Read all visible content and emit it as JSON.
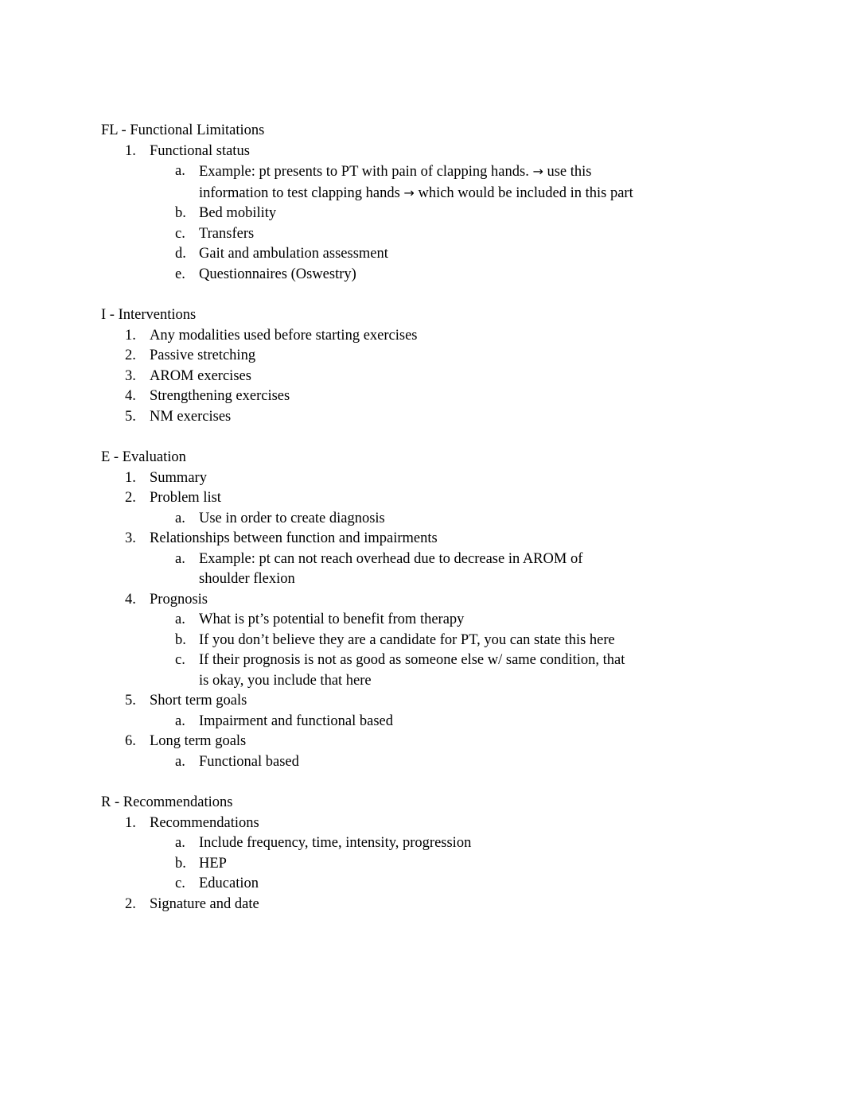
{
  "document": {
    "title": "FL - Functional Limitations",
    "page_background": "#ffffff",
    "text_color": "#000000",
    "sections": [
      {
        "heading": "FL - Functional Limitations",
        "items": [
          {
            "marker": "1.",
            "text": "Functional status",
            "children": [
              {
                "marker": "a.",
                "text": "Example: pt presents to PT with pain of clapping hands. → use this information to test clapping hands → which would be included in this part"
              },
              {
                "marker": "b.",
                "text": "Bed mobility"
              },
              {
                "marker": "c.",
                "text": "Transfers"
              },
              {
                "marker": "d.",
                "text": "Gait and ambulation assessment"
              },
              {
                "marker": "e.",
                "text": "Questionnaires (Oswestry)"
              }
            ]
          }
        ]
      },
      {
        "heading": "I - Interventions",
        "items": [
          {
            "marker": "1.",
            "text": "Any modalities used before starting exercises",
            "children": []
          },
          {
            "marker": "2.",
            "text": "Passive stretching",
            "children": []
          },
          {
            "marker": "3.",
            "text": "AROM exercises",
            "children": []
          },
          {
            "marker": "4.",
            "text": "Strengthening exercises",
            "children": []
          },
          {
            "marker": "5.",
            "text": "NM exercises",
            "children": []
          }
        ]
      },
      {
        "heading": "E - Evaluation",
        "items": [
          {
            "marker": "1.",
            "text": "Summary",
            "children": []
          },
          {
            "marker": "2.",
            "text": "Problem list",
            "children": [
              {
                "marker": "a.",
                "text": "Use in order to create diagnosis"
              }
            ]
          },
          {
            "marker": "3.",
            "text": "Relationships between function and impairments",
            "children": [
              {
                "marker": "a.",
                "text": "Example: pt can not reach overhead due to decrease in AROM of shoulder flexion"
              }
            ]
          },
          {
            "marker": "4.",
            "text": "Prognosis",
            "children": [
              {
                "marker": "a.",
                "text": "What is pt’s potential to benefit from therapy"
              },
              {
                "marker": "b.",
                "text": "If you don’t believe they are a candidate for PT, you can state this here"
              },
              {
                "marker": "c.",
                "text": "If their prognosis is not as good as someone else w/ same condition, that is okay, you include that here"
              }
            ]
          },
          {
            "marker": "5.",
            "text": "Short term goals",
            "children": [
              {
                "marker": "a.",
                "text": "Impairment and functional based"
              }
            ]
          },
          {
            "marker": "6.",
            "text": "Long term goals",
            "children": [
              {
                "marker": "a.",
                "text": "Functional based"
              }
            ]
          }
        ]
      },
      {
        "heading": "R - Recommendations",
        "items": [
          {
            "marker": "1.",
            "text": "Recommendations",
            "children": [
              {
                "marker": "a.",
                "text": "Include frequency, time, intensity, progression"
              },
              {
                "marker": "b.",
                "text": "HEP"
              },
              {
                "marker": "c.",
                "text": "Education"
              }
            ]
          },
          {
            "marker": "2.",
            "text": "Signature and date",
            "children": []
          }
        ]
      }
    ]
  }
}
